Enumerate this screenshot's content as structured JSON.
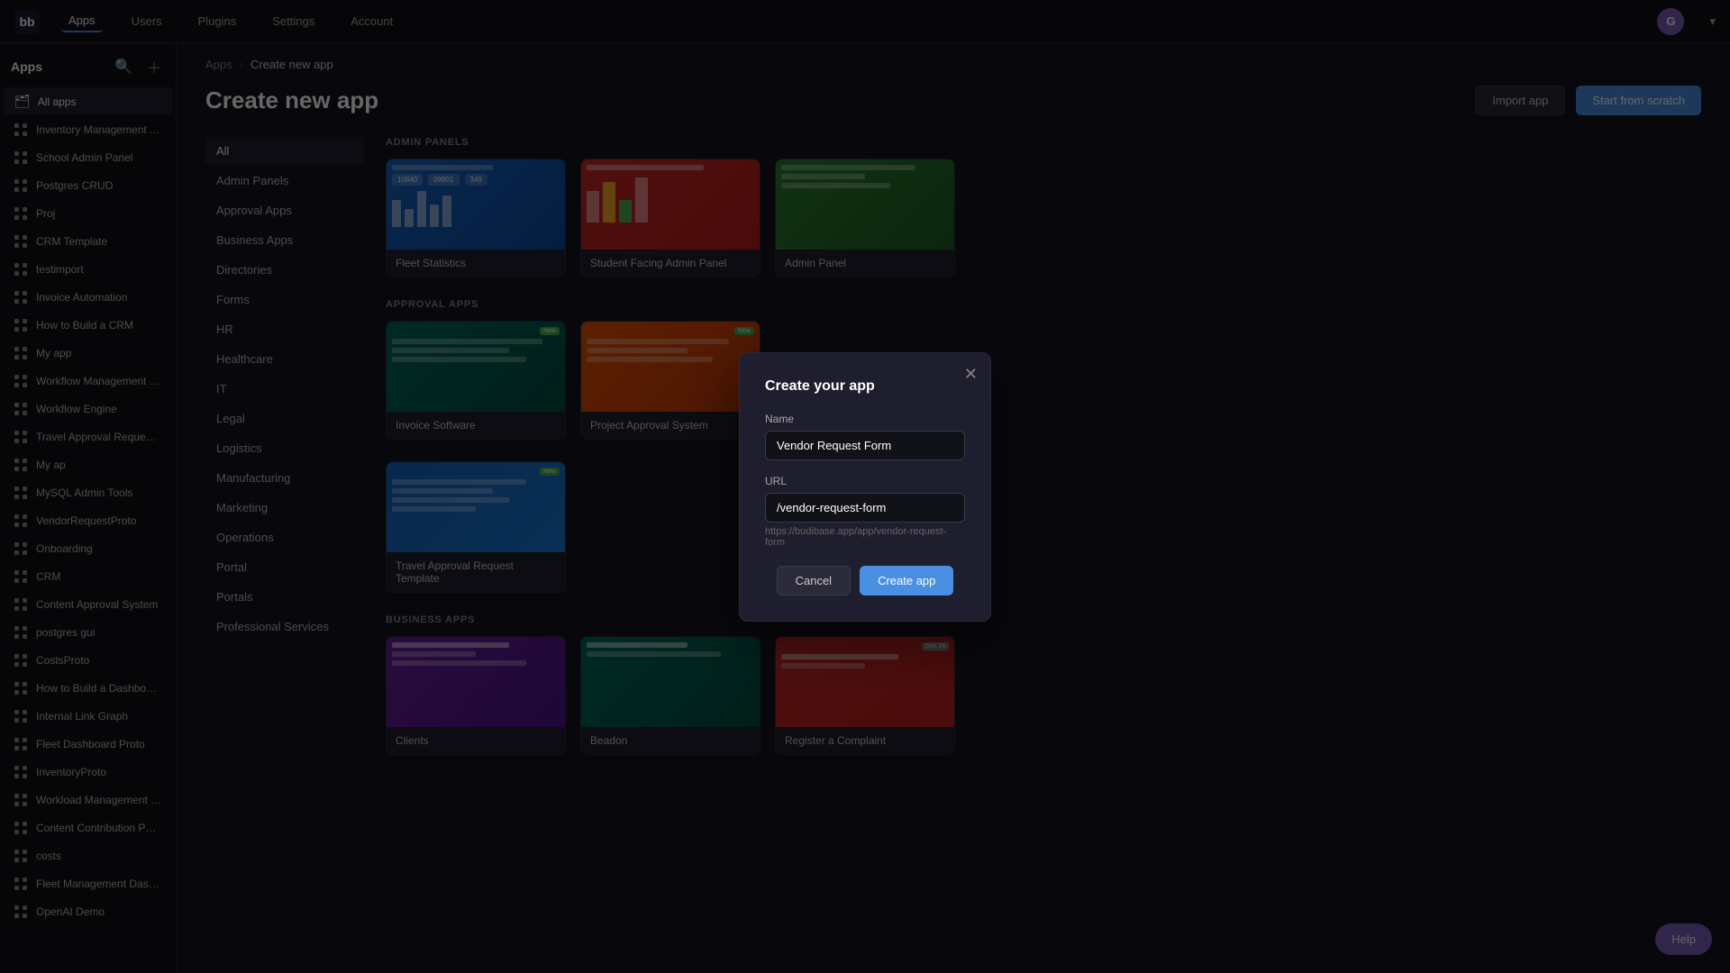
{
  "topNav": {
    "logo": "bb",
    "items": [
      {
        "label": "Apps",
        "active": true
      },
      {
        "label": "Users",
        "active": false
      },
      {
        "label": "Plugins",
        "active": false
      },
      {
        "label": "Settings",
        "active": false
      },
      {
        "label": "Account",
        "active": false
      }
    ],
    "userInitial": "G"
  },
  "sidebar": {
    "title": "Apps",
    "allApps": "All apps",
    "items": [
      {
        "label": "Inventory Management App",
        "color": "#4a90e2"
      },
      {
        "label": "School Admin Panel",
        "color": "#e24a4a"
      },
      {
        "label": "Postgres CRUD",
        "color": "#4a4a4a"
      },
      {
        "label": "Proj",
        "color": "#4a4a4a"
      },
      {
        "label": "CRM Template",
        "color": "#4a4a4a"
      },
      {
        "label": "testimport",
        "color": "#4a4a4a"
      },
      {
        "label": "Invoice Automation",
        "color": "#4a4a4a"
      },
      {
        "label": "How to Build a CRM",
        "color": "#4a4a4a"
      },
      {
        "label": "My app",
        "color": "#4a4a4a"
      },
      {
        "label": "Workflow Management Datab...",
        "color": "#4a4a4a"
      },
      {
        "label": "Workflow Engine",
        "color": "#4a4a4a"
      },
      {
        "label": "Travel Approval Request Temp...",
        "color": "#4a90e2"
      },
      {
        "label": "My ap",
        "color": "#4a4a4a"
      },
      {
        "label": "MySQL Admin Tools",
        "color": "#4a4a4a"
      },
      {
        "label": "VendorRequestProto",
        "color": "#4a4a4a"
      },
      {
        "label": "Onboarding",
        "color": "#4a4a4a"
      },
      {
        "label": "CRM",
        "color": "#4a4a4a"
      },
      {
        "label": "Content Approval System",
        "color": "#e2a84a"
      },
      {
        "label": "postgres gui",
        "color": "#4a4a4a"
      },
      {
        "label": "CostsProto",
        "color": "#4a4a4a"
      },
      {
        "label": "How to Build a Dashboard",
        "color": "#4a4a4a"
      },
      {
        "label": "Internal Link Graph",
        "color": "#4a4a4a"
      },
      {
        "label": "Fleet Dashboard Proto",
        "color": "#4a4a4a"
      },
      {
        "label": "InventoryProto",
        "color": "#4a4a4a"
      },
      {
        "label": "Workload Management Tool",
        "color": "#4a4a4a"
      },
      {
        "label": "Content Contribution Portal",
        "color": "#4a4a4a"
      },
      {
        "label": "costs",
        "color": "#4a4a4a"
      },
      {
        "label": "Fleet Management Dashboard",
        "color": "#4a4a4a"
      },
      {
        "label": "OpenAI Demo",
        "color": "#4a4a4a"
      }
    ]
  },
  "breadcrumb": {
    "parent": "Apps",
    "current": "Create new app"
  },
  "page": {
    "title": "Create new app",
    "importBtn": "Import app",
    "scratchBtn": "Start from scratch"
  },
  "categories": [
    {
      "label": "All",
      "active": true
    },
    {
      "label": "Admin Panels",
      "active": false
    },
    {
      "label": "Approval Apps",
      "active": false
    },
    {
      "label": "Business Apps",
      "active": false
    },
    {
      "label": "Directories",
      "active": false
    },
    {
      "label": "Forms",
      "active": false
    },
    {
      "label": "HR",
      "active": false
    },
    {
      "label": "Healthcare",
      "active": false
    },
    {
      "label": "IT",
      "active": false
    },
    {
      "label": "Legal",
      "active": false
    },
    {
      "label": "Logistics",
      "active": false
    },
    {
      "label": "Manufacturing",
      "active": false
    },
    {
      "label": "Marketing",
      "active": false
    },
    {
      "label": "Operations",
      "active": false
    },
    {
      "label": "Portal",
      "active": false
    },
    {
      "label": "Portals",
      "active": false
    },
    {
      "label": "Professional Services",
      "active": false
    }
  ],
  "sections": {
    "adminPanels": {
      "label": "ADMIN PANELS",
      "cards": [
        {
          "label": "Fleet Statistics",
          "theme": "blue"
        },
        {
          "label": "Student Facing Admin Panel",
          "theme": "red"
        },
        {
          "label": "Admin Panel",
          "theme": "green"
        }
      ]
    },
    "approvalApps": {
      "label": "APPROVAL APPS",
      "cards": [
        {
          "label": "Invoice Software",
          "theme": "teal"
        },
        {
          "label": "Project Approval System",
          "theme": "orange"
        }
      ]
    },
    "travelCard": {
      "label": "Travel Approval Request Template",
      "theme": "blue"
    },
    "businessApps": {
      "label": "BUSINESS APPS",
      "cards": [
        {
          "label": "Clients",
          "theme": "purple"
        },
        {
          "label": "Beadon",
          "theme": "green"
        },
        {
          "label": "Register a Complaint",
          "theme": "red"
        }
      ]
    }
  },
  "modal": {
    "title": "Create your app",
    "nameLabel": "Name",
    "nameValue": "Vendor Request Form",
    "namePlaceholder": "Vendor Request Form",
    "urlLabel": "URL",
    "urlValue": "/vendor-request-form",
    "urlPlaceholder": "/vendor-request-form",
    "urlHint": "https://budibase.app/app/vendor-request-form",
    "cancelBtn": "Cancel",
    "createBtn": "Create app"
  },
  "helpBtn": "Help"
}
